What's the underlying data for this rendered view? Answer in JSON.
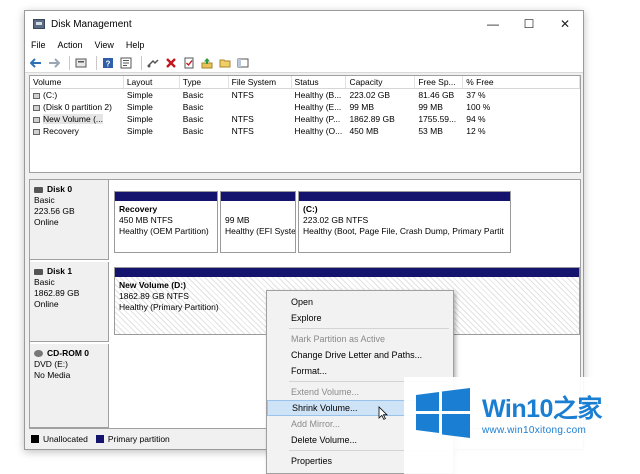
{
  "window": {
    "title": "Disk Management",
    "controls": {
      "minimize": "—",
      "maximize": "☐",
      "close": "✕"
    }
  },
  "menu": [
    "File",
    "Action",
    "View",
    "Help"
  ],
  "volume_table": {
    "headers": [
      "Volume",
      "Layout",
      "Type",
      "File System",
      "Status",
      "Capacity",
      "Free Sp...",
      "% Free"
    ],
    "rows": [
      [
        "(C:)",
        "Simple",
        "Basic",
        "NTFS",
        "Healthy (B...",
        "223.02 GB",
        "81.46 GB",
        "37 %"
      ],
      [
        "(Disk 0 partition 2)",
        "Simple",
        "Basic",
        "",
        "Healthy (E...",
        "99 MB",
        "99 MB",
        "100 %"
      ],
      [
        "New Volume (...",
        "Simple",
        "Basic",
        "NTFS",
        "Healthy (P...",
        "1862.89 GB",
        "1755.59...",
        "94 %"
      ],
      [
        "Recovery",
        "Simple",
        "Basic",
        "NTFS",
        "Healthy (O...",
        "450 MB",
        "53 MB",
        "12 %"
      ]
    ]
  },
  "disks": [
    {
      "name": "Disk 0",
      "type": "Basic",
      "size": "223.56 GB",
      "status": "Online",
      "partitions": [
        {
          "name": "Recovery",
          "size": "450 MB NTFS",
          "status": "Healthy (OEM Partition)"
        },
        {
          "name": "",
          "size": "99 MB",
          "status": "Healthy (EFI Syste"
        },
        {
          "name": "(C:)",
          "size": "223.02 GB NTFS",
          "status": "Healthy (Boot, Page File, Crash Dump, Primary Partit"
        }
      ]
    },
    {
      "name": "Disk 1",
      "type": "Basic",
      "size": "1862.89 GB",
      "status": "Online",
      "partitions": [
        {
          "name": "New Volume  (D:)",
          "size": "1862.89 GB NTFS",
          "status": "Healthy (Primary Partition)"
        }
      ]
    },
    {
      "name": "CD-ROM 0",
      "type": "DVD (E:)",
      "size": "",
      "status": "No Media",
      "partitions": []
    }
  ],
  "legend": [
    {
      "label": "Unallocated",
      "color": "#000000"
    },
    {
      "label": "Primary partition",
      "color": "#14146e"
    }
  ],
  "context_menu": {
    "items": [
      {
        "label": "Open",
        "disabled": false
      },
      {
        "label": "Explore",
        "disabled": false
      },
      {
        "label": "Mark Partition as Active",
        "disabled": true
      },
      {
        "label": "Change Drive Letter and Paths...",
        "disabled": false
      },
      {
        "label": "Format...",
        "disabled": false
      },
      {
        "label": "Extend Volume...",
        "disabled": true
      },
      {
        "label": "Shrink Volume...",
        "disabled": false,
        "highlighted": true
      },
      {
        "label": "Add Mirror...",
        "disabled": true
      },
      {
        "label": "Delete Volume...",
        "disabled": false
      },
      {
        "label": "Properties",
        "disabled": false
      }
    ]
  },
  "watermark": {
    "brand": "Win10",
    "brand_suffix": "之家",
    "url": "www.win10xitong.com",
    "accent": "#1a7ed2"
  }
}
